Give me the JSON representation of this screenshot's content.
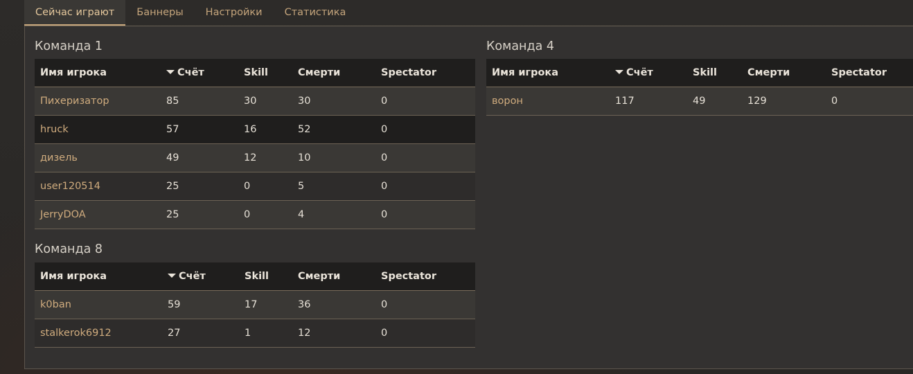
{
  "tabs": [
    {
      "label": "Сейчас играют",
      "active": true
    },
    {
      "label": "Баннеры",
      "active": false
    },
    {
      "label": "Настройки",
      "active": false
    },
    {
      "label": "Статистика",
      "active": false
    }
  ],
  "columns": {
    "name": "Имя игрока",
    "score": "Счёт",
    "skill": "Skill",
    "deaths": "Смерти",
    "spectator": "Spectator"
  },
  "teams": [
    {
      "title": "Команда 1",
      "rows": [
        {
          "name": "Пихеризатор",
          "score": "85",
          "skill": "30",
          "deaths": "30",
          "spectator": "0"
        },
        {
          "name": "hruck",
          "score": "57",
          "skill": "16",
          "deaths": "52",
          "spectator": "0"
        },
        {
          "name": "дизель",
          "score": "49",
          "skill": "12",
          "deaths": "10",
          "spectator": "0"
        },
        {
          "name": "user120514",
          "score": "25",
          "skill": "0",
          "deaths": "5",
          "spectator": "0"
        },
        {
          "name": "JerryDOA",
          "score": "25",
          "skill": "0",
          "deaths": "4",
          "spectator": "0"
        }
      ]
    },
    {
      "title": "Команда 4",
      "rows": [
        {
          "name": "ворон",
          "score": "117",
          "skill": "49",
          "deaths": "129",
          "spectator": "0"
        }
      ]
    },
    {
      "title": "Команда 8",
      "rows": [
        {
          "name": "k0ban",
          "score": "59",
          "skill": "17",
          "deaths": "36",
          "spectator": "0"
        },
        {
          "name": "stalkerok6912",
          "score": "27",
          "skill": "1",
          "deaths": "12",
          "spectator": "0"
        }
      ]
    }
  ],
  "colors": {
    "accent": "#c8a77c",
    "player_name": "#d0ac7e",
    "header_bg": "#1f1e1d",
    "panel_bg": "#333130"
  },
  "icons": {
    "sort": "sort-desc-icon"
  }
}
